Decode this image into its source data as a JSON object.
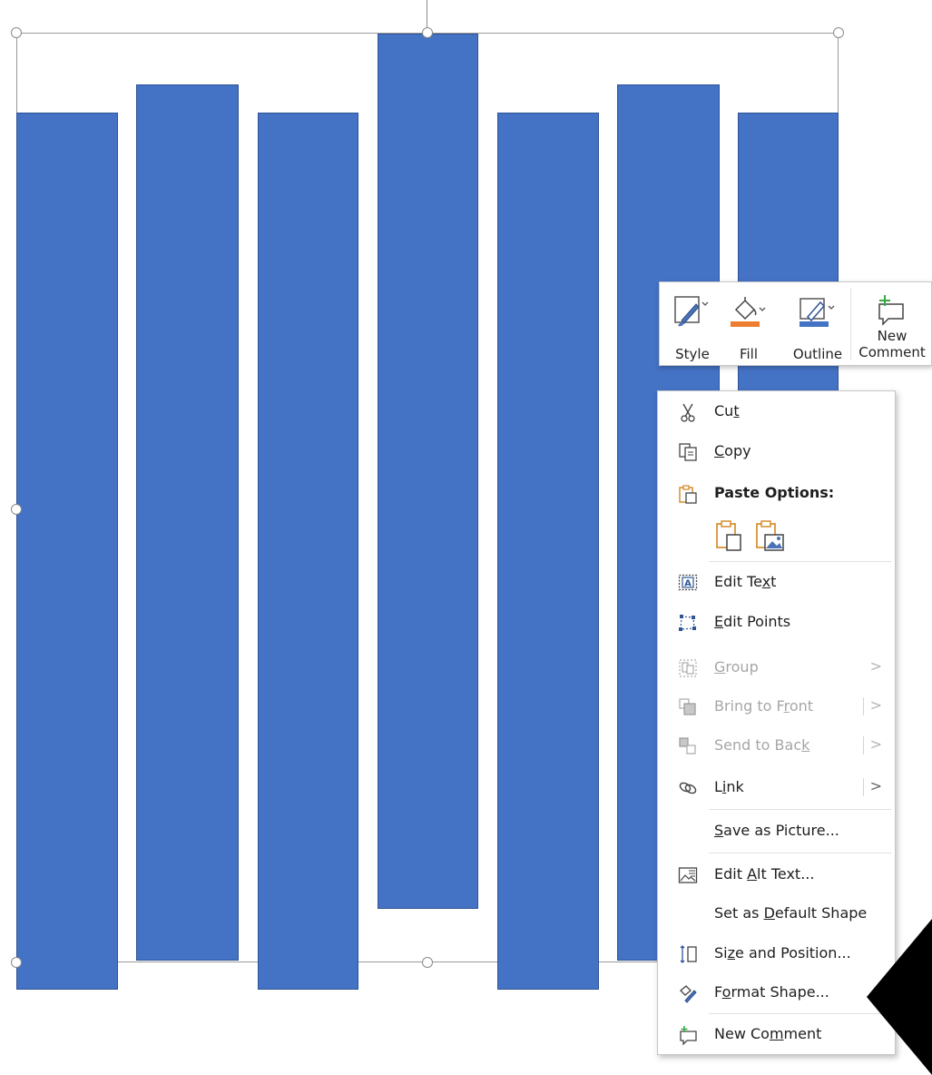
{
  "canvas": {
    "fill_color": "#4472c4",
    "outline_color": "#2f5496"
  },
  "mini_toolbar": {
    "style_label": "Style",
    "fill_label": "Fill",
    "outline_label": "Outline",
    "new_comment_label": "New Comment",
    "fill_swatch": "#ed7d31",
    "outline_swatch": "#4472c4"
  },
  "context_menu": {
    "cut": {
      "pre": "Cu",
      "u": "t",
      "post": ""
    },
    "copy": {
      "pre": "",
      "u": "C",
      "post": "opy"
    },
    "paste_options": "Paste Options:",
    "edit_text": {
      "pre": "Edit Te",
      "u": "x",
      "post": "t"
    },
    "edit_points": {
      "pre": "",
      "u": "E",
      "post": "dit Points"
    },
    "group": {
      "pre": "",
      "u": "G",
      "post": "roup"
    },
    "bring_to_front": {
      "pre": "Bring to F",
      "u": "r",
      "post": "ont"
    },
    "send_to_back": {
      "pre": "Send to Bac",
      "u": "k",
      "post": ""
    },
    "link": {
      "pre": "L",
      "u": "i",
      "post": "nk"
    },
    "save_as_picture": {
      "pre": "",
      "u": "S",
      "post": "ave as Picture..."
    },
    "edit_alt_text": {
      "pre": "Edit ",
      "u": "A",
      "post": "lt Text..."
    },
    "set_default_shape": {
      "pre": "Set as ",
      "u": "D",
      "post": "efault Shape"
    },
    "size_and_position": {
      "pre": "Si",
      "u": "z",
      "post": "e and Position..."
    },
    "format_shape": {
      "pre": "F",
      "u": "o",
      "post": "rmat Shape..."
    },
    "new_comment": {
      "pre": "New Co",
      "u": "m",
      "post": "ment"
    },
    "submenu_arrow": ">"
  }
}
